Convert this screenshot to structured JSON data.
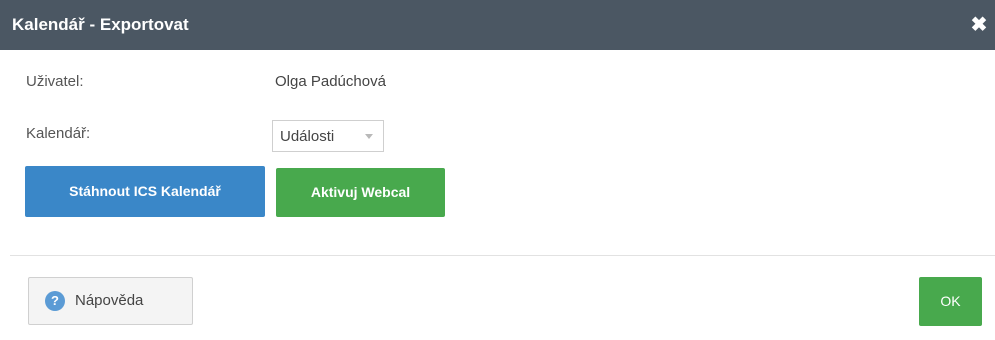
{
  "dialog": {
    "title": "Kalendář - Exportovat",
    "close_icon": "close-icon"
  },
  "form": {
    "user_label": "Uživatel:",
    "user_value": "Olga Padúchová",
    "calendar_label": "Kalendář:",
    "calendar_selected": "Události"
  },
  "actions": {
    "download_ics_label": "Stáhnout ICS Kalendář",
    "activate_webcal_label": "Aktivuj Webcal"
  },
  "footer": {
    "help_label": "Nápověda",
    "help_icon": "question-circle-icon",
    "ok_label": "OK"
  },
  "colors": {
    "titlebar": "#4b5763",
    "primary_blue": "#3a87c8",
    "success_green": "#48a94d"
  }
}
